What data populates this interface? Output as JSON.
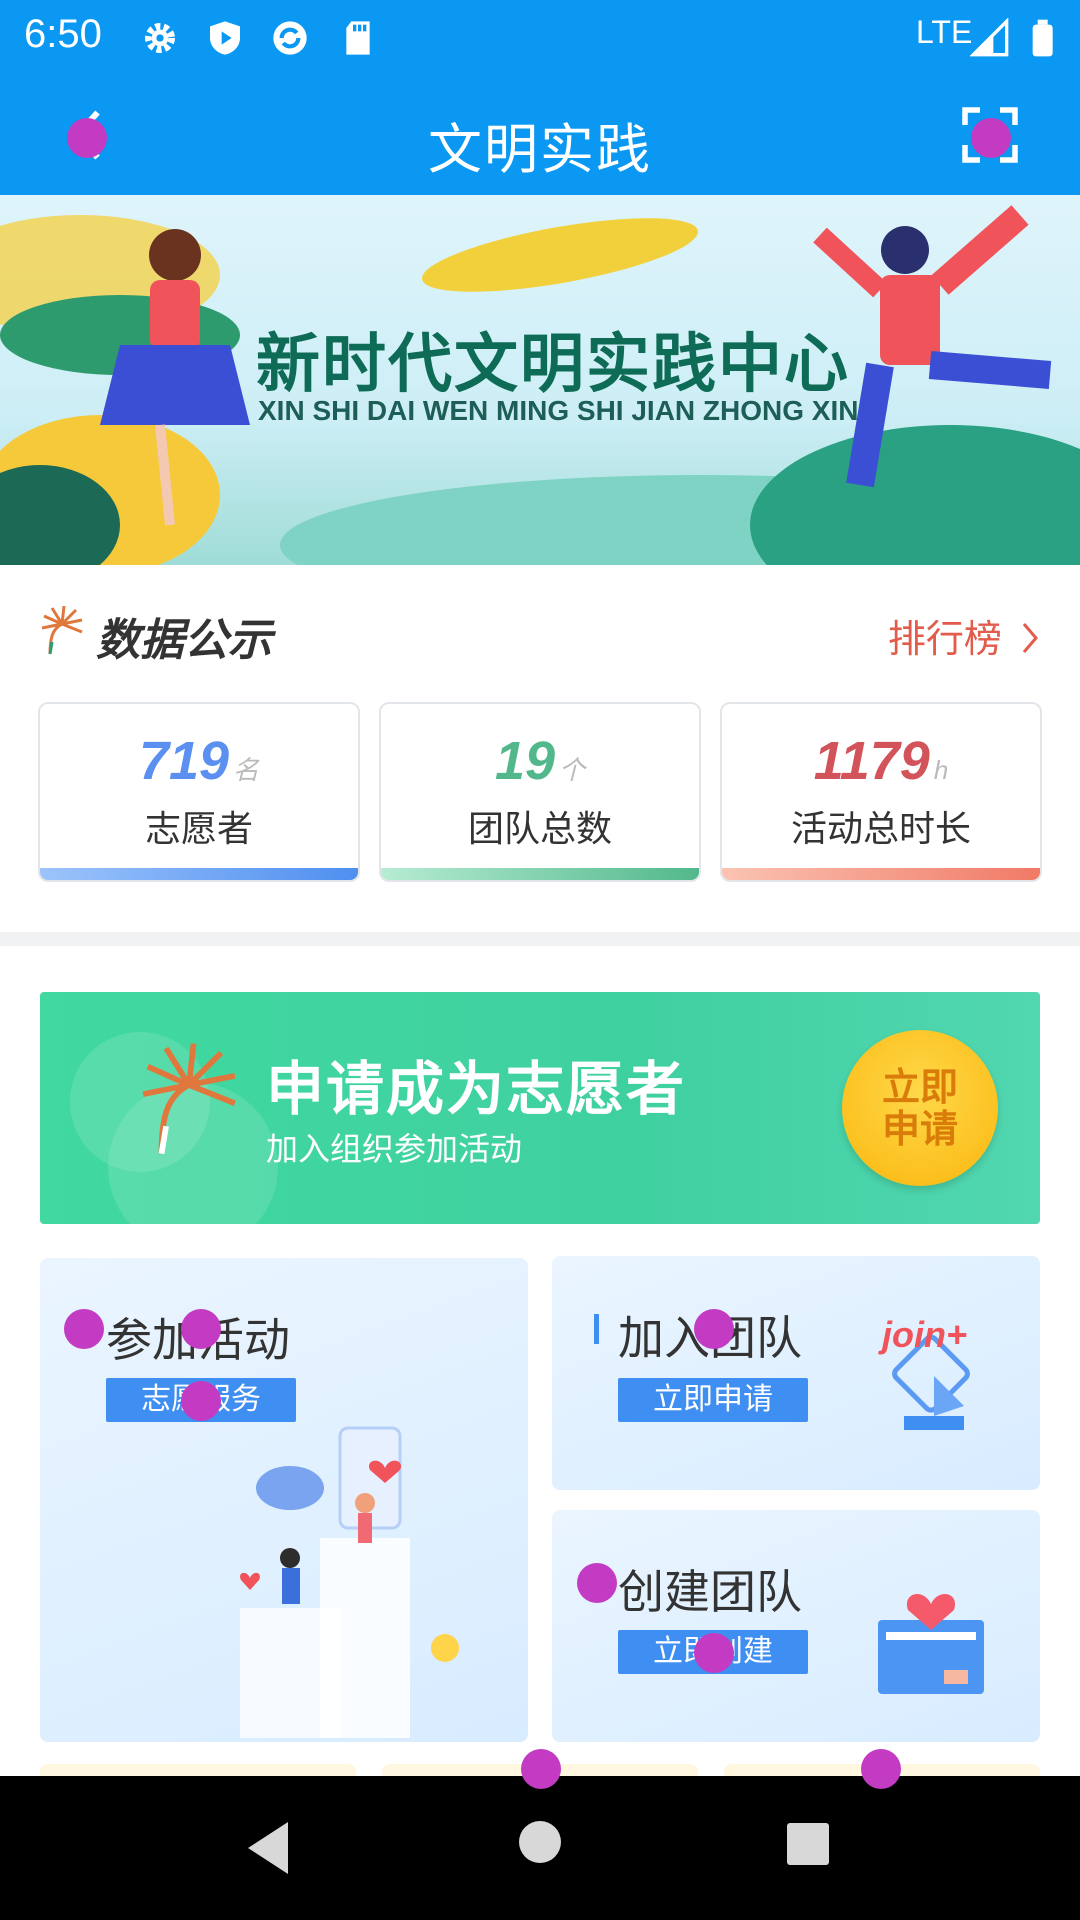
{
  "status_bar": {
    "time": "6:50",
    "network": "LTE",
    "icons": [
      "settings-icon",
      "shield-play-icon",
      "sync-icon",
      "sd-card-icon",
      "signal-icon",
      "battery-icon"
    ]
  },
  "header": {
    "title": "文明实践",
    "back_icon": "back-arrow-icon",
    "scan_icon": "scan-icon"
  },
  "banner": {
    "title": "新时代文明实践中心",
    "subtitle": "XIN SHI DAI WEN MING SHI JIAN ZHONG XIN"
  },
  "data_section": {
    "title": "数据公示",
    "ranking_link": "排行榜",
    "stats": [
      {
        "value": "719",
        "unit": "名",
        "label": "志愿者",
        "color": "#5b8ff0"
      },
      {
        "value": "19",
        "unit": "个",
        "label": "团队总数",
        "color": "#52b88c"
      },
      {
        "value": "1179",
        "unit": "h",
        "label": "活动总时长",
        "color": "#d2535a"
      }
    ]
  },
  "apply_banner": {
    "title": "申请成为志愿者",
    "subtitle": "加入组织参加活动",
    "button_line1": "立即",
    "button_line2": "申请"
  },
  "function_cards": {
    "join_activity": {
      "title": "参加活动",
      "tag": "志愿服务"
    },
    "join_team": {
      "title": "加入团队",
      "tag": "立即申请",
      "badge": "join+"
    },
    "create_team": {
      "title": "创建团队",
      "tag": "立即创建"
    }
  },
  "colors": {
    "primary": "#0a98f2",
    "accent_red": "#e25b4b",
    "tag_blue": "#3f8ef2",
    "green": "#41d9a0"
  }
}
